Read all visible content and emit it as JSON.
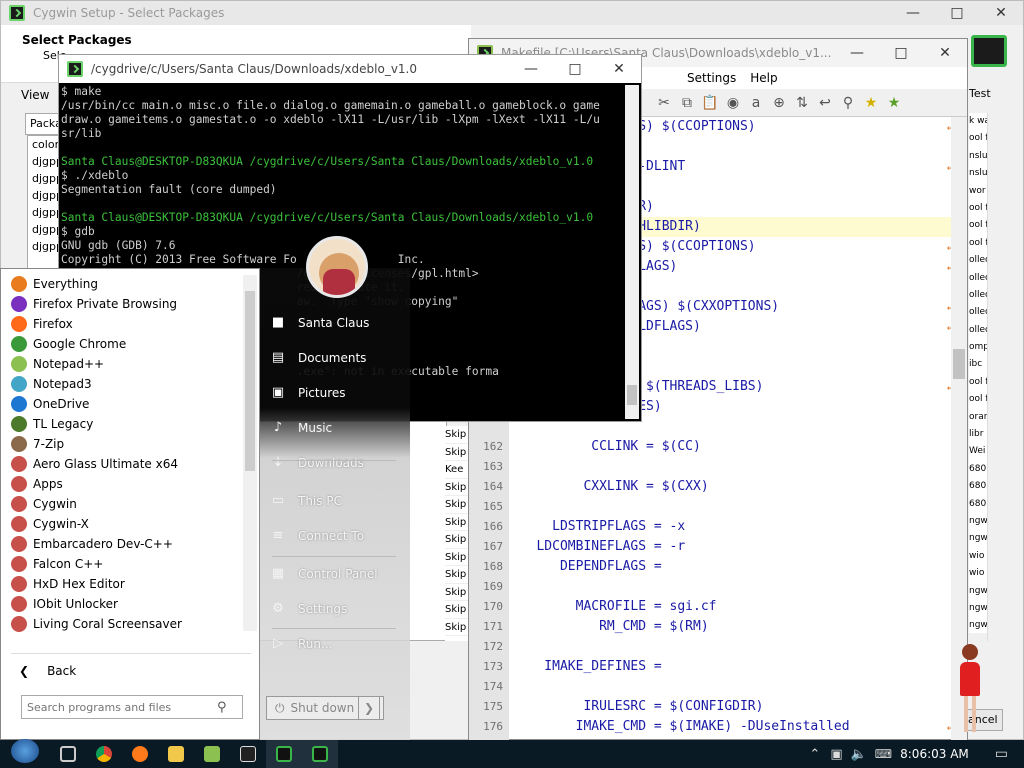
{
  "setup": {
    "title": "Cygwin Setup - Select Packages",
    "heading": "Select Packages",
    "subheading": "Sele",
    "view_label": "View",
    "tabs": [
      "Packa"
    ],
    "right_tab": "Test",
    "cancel_label": "ancel",
    "packages": [
      "colorg",
      "djgpp",
      "djgpp",
      "djgpp",
      "djgpp",
      "djgpp",
      "djgpp"
    ],
    "skip_list": [
      "Skip",
      "Skip",
      "Kee",
      "Skip",
      "Skip",
      "Skip",
      "Skip",
      "Skip",
      "Skip",
      "Skip",
      "Skip",
      "Skip"
    ],
    "right_list": [
      "k wa",
      "ool f",
      "nslu",
      "nslu",
      "wor",
      "ool f",
      "ool f",
      "ool f",
      "ollec",
      "ollec",
      "ollec",
      "ollec",
      "ollec",
      "ompi",
      "ibc",
      "ool f",
      "ool f",
      "orar",
      "libr",
      "Wei",
      "680",
      "680",
      "680",
      "ngw",
      "ngw",
      "wio",
      "wio",
      "ngw",
      "ngw",
      "ngw"
    ]
  },
  "terminal": {
    "title": "/cygdrive/c/Users/Santa Claus/Downloads/xdeblo_v1.0",
    "lines": [
      {
        "t": "$ make",
        "c": ""
      },
      {
        "t": "/usr/bin/cc main.o misc.o file.o dialog.o gamemain.o gameball.o gameblock.o game",
        "c": ""
      },
      {
        "t": "draw.o gameitems.o gamestat.o -o xdeblo -lX11 -L/usr/lib -lXpm -lXext -lX11 -L/u",
        "c": ""
      },
      {
        "t": "sr/lib",
        "c": ""
      },
      {
        "t": "",
        "c": ""
      },
      {
        "t": "Santa Claus@DESKTOP-D83QKUA /cygdrive/c/Users/Santa Claus/Downloads/xdeblo_v1.0",
        "c": "prompt"
      },
      {
        "t": "$ ./xdeblo",
        "c": ""
      },
      {
        "t": "Segmentation fault (core dumped)",
        "c": ""
      },
      {
        "t": "",
        "c": ""
      },
      {
        "t": "Santa Claus@DESKTOP-D83QKUA /cygdrive/c/Users/Santa Claus/Downloads/xdeblo_v1.0",
        "c": "prompt"
      },
      {
        "t": "$ gdb",
        "c": ""
      },
      {
        "t": "GNU gdb (GDB) 7.6",
        "c": ""
      },
      {
        "t": "Copyright (C) 2013 Free Software Fo               Inc.",
        "c": ""
      },
      {
        "t": "                                   /gnu.org/licenses/gpl.html>",
        "c": ""
      },
      {
        "t": "                                   redistribute it.",
        "c": ""
      },
      {
        "t": "                                   aw.  Type \"show copying\"",
        "c": ""
      },
      {
        "t": "",
        "c": ""
      },
      {
        "t": "",
        "c": ""
      },
      {
        "t": "",
        "c": ""
      },
      {
        "t": "",
        "c": ""
      },
      {
        "t": "                                   .exe\": not in executable forma",
        "c": ""
      }
    ]
  },
  "npp": {
    "title": "Makefile [C:\\Users\\Santa Claus\\Downloads\\xdeblo_v1...",
    "menu": [
      "Settings",
      "Help"
    ],
    "lines": [
      {
        "n": "",
        "code": "S = $(CDEBUGFLAGS) $(CCOPTIONS)",
        "wrap": true,
        "hl": false,
        "indent": 0
      },
      {
        "n": "",
        "code": ") $(ALLDEFINES)",
        "wrap": false,
        "hl": false,
        "indent": 0
      },
      {
        "n": "",
        "code": "S = $(LINTOPTS) -DLINT",
        "wrap": true,
        "hl": false,
        "indent": 0
      },
      {
        "n": "",
        "code": "DEPEND_DEFINES)",
        "wrap": false,
        "hl": false,
        "indent": 0
      },
      {
        "n": "",
        "code": "B = -L$(USRLIBDIR)",
        "wrap": false,
        "hl": false,
        "indent": 0
      },
      {
        "n": "",
        "code": "B = -L$(ROOT)$(SHLIBDIR)",
        "wrap": false,
        "hl": true,
        "indent": 0
      },
      {
        "n": "",
        "code": "S = $(CDEBUGFLAGS) $(CCOPTIONS)",
        "wrap": true,
        "hl": false,
        "indent": 0
      },
      {
        "n": "",
        "code": "S) $(THREADS_LDFLAGS)",
        "wrap": true,
        "hl": false,
        "indent": 0
      },
      {
        "n": "",
        "code": " $(LDPRELIB)",
        "wrap": false,
        "hl": false,
        "indent": 0
      },
      {
        "n": "",
        "code": "S = $(CXXDEBUGFLAGS) $(CXXOPTIONS)",
        "wrap": true,
        "hl": false,
        "indent": 0
      },
      {
        "n": "",
        "code": "S) $(THREADS_CXXLDFLAGS)",
        "wrap": true,
        "hl": false,
        "indent": 0
      },
      {
        "n": "",
        "code": " $(LDPRELIB)",
        "wrap": false,
        "hl": false,
        "indent": 0
      },
      {
        "n": "",
        "code": "",
        "wrap": false,
        "hl": false,
        "indent": 0
      },
      {
        "n": "",
        "code": "S = $(LDPOSTLIB) $(THREADS_LIBS)",
        "wrap": true,
        "hl": false,
        "indent": 0
      },
      {
        "n": "",
        "code": " $(EXTRA_LIBRARIES)",
        "wrap": false,
        "hl": false,
        "indent": 0
      },
      {
        "n": "",
        "code": "",
        "wrap": false,
        "hl": false,
        "indent": 0
      },
      {
        "n": "162",
        "code": "          CCLINK = $(CC)",
        "wrap": false,
        "hl": false,
        "indent": 0
      },
      {
        "n": "163",
        "code": "",
        "wrap": false,
        "hl": false,
        "indent": 0
      },
      {
        "n": "164",
        "code": "         CXXLINK = $(CXX)",
        "wrap": false,
        "hl": false,
        "indent": 0
      },
      {
        "n": "165",
        "code": "",
        "wrap": false,
        "hl": false,
        "indent": 0
      },
      {
        "n": "166",
        "code": "     LDSTRIPFLAGS = -x",
        "wrap": false,
        "hl": false,
        "indent": 0
      },
      {
        "n": "167",
        "code": "   LDCOMBINEFLAGS = -r",
        "wrap": false,
        "hl": false,
        "indent": 0
      },
      {
        "n": "168",
        "code": "      DEPENDFLAGS =",
        "wrap": false,
        "hl": false,
        "indent": 0
      },
      {
        "n": "169",
        "code": "",
        "wrap": false,
        "hl": false,
        "indent": 0
      },
      {
        "n": "170",
        "code": "        MACROFILE = sgi.cf",
        "wrap": false,
        "hl": false,
        "indent": 0
      },
      {
        "n": "171",
        "code": "           RM_CMD = $(RM)",
        "wrap": false,
        "hl": false,
        "indent": 0
      },
      {
        "n": "172",
        "code": "",
        "wrap": false,
        "hl": false,
        "indent": 0
      },
      {
        "n": "173",
        "code": "    IMAKE_DEFINES =",
        "wrap": false,
        "hl": false,
        "indent": 0
      },
      {
        "n": "174",
        "code": "",
        "wrap": false,
        "hl": false,
        "indent": 0
      },
      {
        "n": "175",
        "code": "         IRULESRC = $(CONFIGDIR)",
        "wrap": false,
        "hl": false,
        "indent": 0
      },
      {
        "n": "176",
        "code": "        IMAKE_CMD = $(IMAKE) -DUseInstalled",
        "wrap": true,
        "hl": false,
        "indent": 0
      }
    ]
  },
  "start": {
    "programs": [
      {
        "label": "Everything",
        "color": "#e87c1e"
      },
      {
        "label": "Firefox Private Browsing",
        "color": "#7b2fbe"
      },
      {
        "label": "Firefox",
        "color": "#ff6a1a"
      },
      {
        "label": "Google Chrome",
        "color": "#3a9a3a"
      },
      {
        "label": "Notepad++",
        "color": "#8cc152"
      },
      {
        "label": "Notepad3",
        "color": "#44a6c6"
      },
      {
        "label": "OneDrive",
        "color": "#1e78d2"
      },
      {
        "label": "TL Legacy",
        "color": "#4a7a2a"
      },
      {
        "label": "7-Zip",
        "color": "#8a6a4a"
      },
      {
        "label": "Aero Glass Ultimate x64",
        "color": "#c8504a"
      },
      {
        "label": "Apps",
        "color": "#c8504a"
      },
      {
        "label": "Cygwin",
        "color": "#c8504a"
      },
      {
        "label": "Cygwin-X",
        "color": "#c8504a"
      },
      {
        "label": "Embarcadero Dev-C++",
        "color": "#c8504a"
      },
      {
        "label": "Falcon C++",
        "color": "#c8504a"
      },
      {
        "label": "HxD Hex Editor",
        "color": "#c8504a"
      },
      {
        "label": "IObit Unlocker",
        "color": "#c8504a"
      },
      {
        "label": "Living Coral Screensaver",
        "color": "#c8504a"
      }
    ],
    "back_label": "Back",
    "search_placeholder": "Search programs and files",
    "right_items": [
      {
        "label": "Santa Claus",
        "icon": "user-icon",
        "dark": true
      },
      {
        "label": "Documents",
        "icon": "document-icon",
        "dark": true
      },
      {
        "label": "Pictures",
        "icon": "picture-icon",
        "dark": true
      },
      {
        "label": "Music",
        "icon": "music-icon",
        "dark": false
      },
      {
        "label": "Downloads",
        "icon": "download-icon",
        "dark": false
      },
      {
        "label": "This PC",
        "icon": "computer-icon",
        "dark": false
      },
      {
        "label": "Connect To",
        "icon": "connect-icon",
        "dark": false
      },
      {
        "label": "Control Panel",
        "icon": "control-panel-icon",
        "dark": false
      },
      {
        "label": "Settings",
        "icon": "gear-icon",
        "dark": false
      },
      {
        "label": "Run...",
        "icon": "run-icon",
        "dark": false
      }
    ],
    "shutdown_label": "Shut down"
  },
  "taskbar": {
    "clock": "8:06:03 AM"
  }
}
